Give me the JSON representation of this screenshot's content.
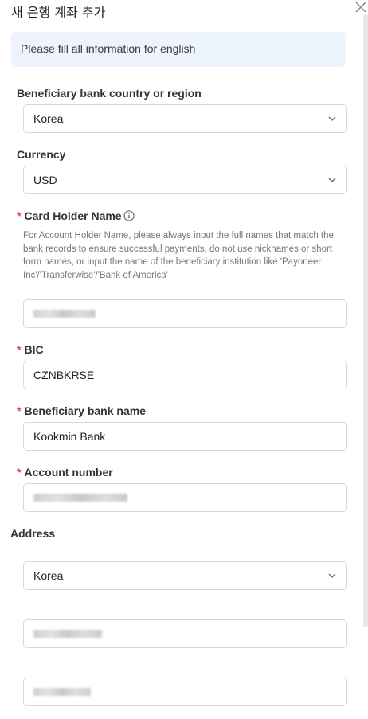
{
  "header": {
    "title": "새 은행 계좌 추가",
    "close_icon": "close-icon"
  },
  "notice": "Please fill all information for english",
  "fields": {
    "country": {
      "label": "Beneficiary bank country or region",
      "value": "Korea"
    },
    "currency": {
      "label": "Currency",
      "value": "USD"
    },
    "holder": {
      "required_mark": "*",
      "label": "Card Holder Name",
      "help": "For Account Holder Name, please always input the full names that match the bank records to ensure successful payments, do not use nicknames or short form names, or input the name of the beneficiary institution like 'Payoneer Inc'/'Transferwise'/'Bank of America'"
    },
    "bic": {
      "required_mark": "*",
      "label": "BIC",
      "value": "CZNBKRSE"
    },
    "bank_name": {
      "required_mark": "*",
      "label": "Beneficiary bank name",
      "value": "Kookmin Bank"
    },
    "account": {
      "required_mark": "*",
      "label": "Account number"
    }
  },
  "address": {
    "title": "Address",
    "country_value": "Korea"
  },
  "colors": {
    "required": "#e2453c",
    "notice_bg": "#eef4fd",
    "border": "#d5d8dc"
  }
}
